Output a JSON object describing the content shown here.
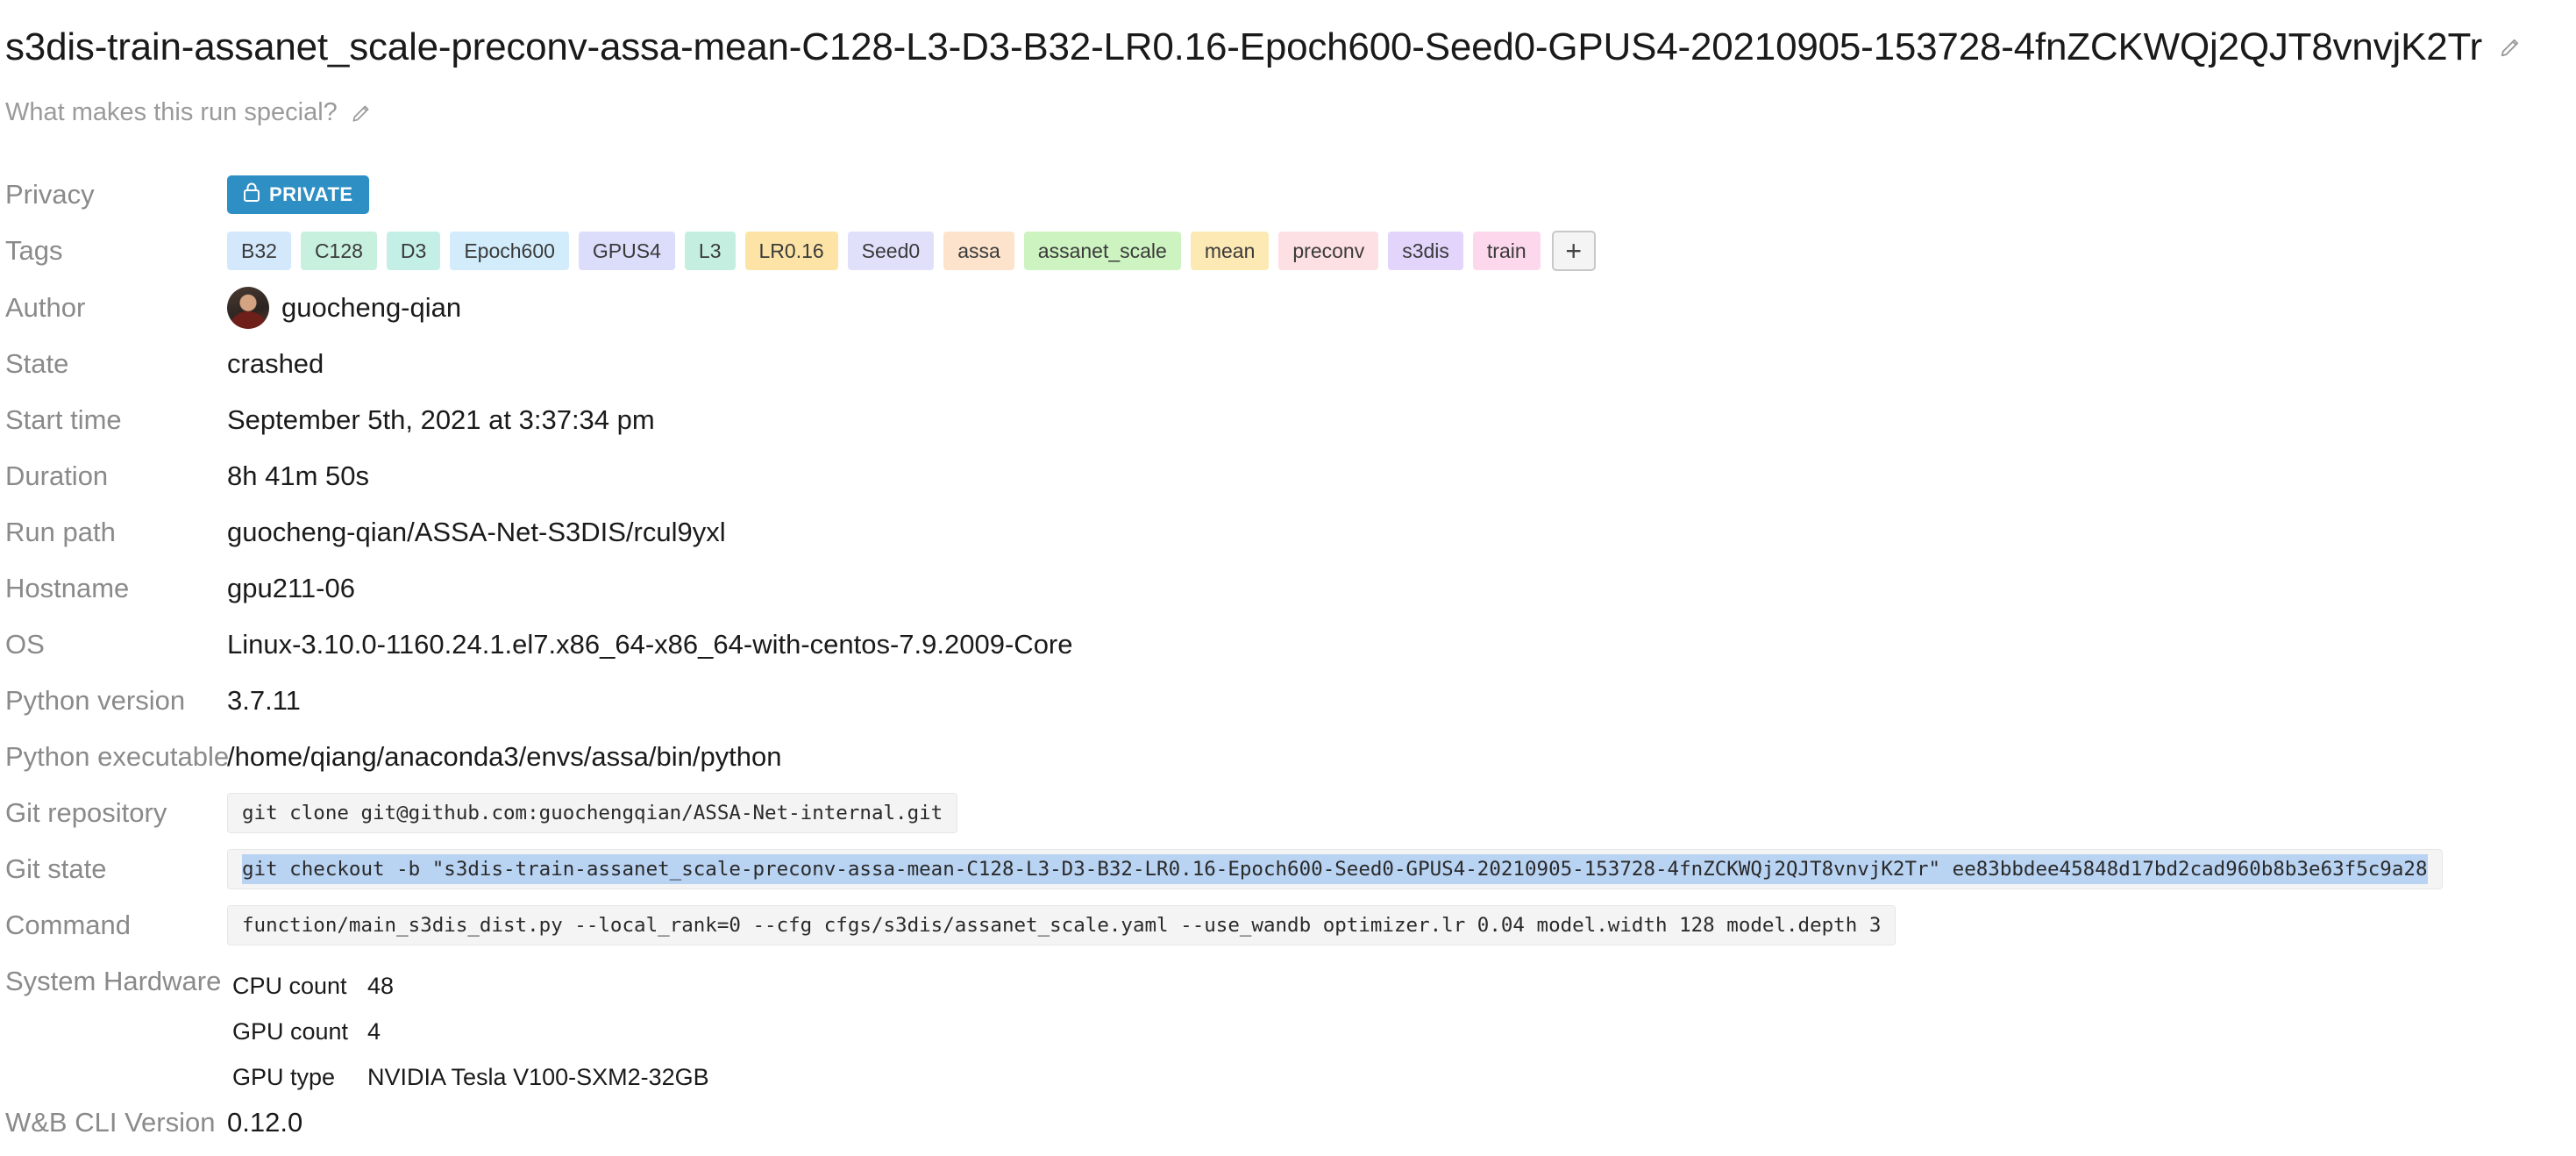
{
  "run": {
    "title": "s3dis-train-assanet_scale-preconv-assa-mean-C128-L3-D3-B32-LR0.16-Epoch600-Seed0-GPUS4-20210905-153728-4fnZCKWQj2QJT8vnvjK2Tr",
    "notes_placeholder": "What makes this run special?"
  },
  "labels": {
    "privacy": "Privacy",
    "tags": "Tags",
    "author": "Author",
    "state": "State",
    "start_time": "Start time",
    "duration": "Duration",
    "run_path": "Run path",
    "hostname": "Hostname",
    "os": "OS",
    "python_version": "Python version",
    "python_executable": "Python executable",
    "git_repository": "Git repository",
    "git_state": "Git state",
    "command": "Command",
    "system_hardware": "System Hardware",
    "cli_version": "W&B CLI Version"
  },
  "privacy": {
    "label": "PRIVATE",
    "color": "#2e8fc4"
  },
  "tags": [
    {
      "label": "B32",
      "color": "#d4e8fb"
    },
    {
      "label": "C128",
      "color": "#c8f0df"
    },
    {
      "label": "D3",
      "color": "#c4efe6"
    },
    {
      "label": "Epoch600",
      "color": "#d2ecfb"
    },
    {
      "label": "GPUS4",
      "color": "#dcdcfb"
    },
    {
      "label": "L3",
      "color": "#c4efe0"
    },
    {
      "label": "LR0.16",
      "color": "#fde4a6"
    },
    {
      "label": "Seed0",
      "color": "#e0e0fb"
    },
    {
      "label": "assa",
      "color": "#fde3cc"
    },
    {
      "label": "assanet_scale",
      "color": "#cdf3c0"
    },
    {
      "label": "mean",
      "color": "#fde9b4"
    },
    {
      "label": "preconv",
      "color": "#fde0e3"
    },
    {
      "label": "s3dis",
      "color": "#e2d4fb"
    },
    {
      "label": "train",
      "color": "#fdd8ec"
    }
  ],
  "tag_add": "+",
  "author": "guocheng-qian",
  "state": "crashed",
  "start_time": "September 5th, 2021 at 3:37:34 pm",
  "duration": "8h 41m 50s",
  "run_path": "guocheng-qian/ASSA-Net-S3DIS/rcul9yxl",
  "hostname": "gpu211-06",
  "os": "Linux-3.10.0-1160.24.1.el7.x86_64-x86_64-with-centos-7.9.2009-Core",
  "python_version": "3.7.11",
  "python_executable": "/home/qiang/anaconda3/envs/assa/bin/python",
  "git_repository": "git clone git@github.com:guochengqian/ASSA-Net-internal.git",
  "git_state": "git checkout -b \"s3dis-train-assanet_scale-preconv-assa-mean-C128-L3-D3-B32-LR0.16-Epoch600-Seed0-GPUS4-20210905-153728-4fnZCKWQj2QJT8vnvjK2Tr\" ee83bbdee45848d17bd2cad960b8b3e63f5c9a28",
  "command": "function/main_s3dis_dist.py --local_rank=0 --cfg cfgs/s3dis/assanet_scale.yaml --use_wandb optimizer.lr 0.04 model.width 128 model.depth 3",
  "hardware": [
    {
      "key": "CPU count",
      "value": "48"
    },
    {
      "key": "GPU count",
      "value": "4"
    },
    {
      "key": "GPU type",
      "value": "NVIDIA Tesla V100-SXM2-32GB"
    }
  ],
  "cli_version": "0.12.0",
  "icons": {
    "edit": "pencil-icon",
    "lock": "lock-icon"
  }
}
